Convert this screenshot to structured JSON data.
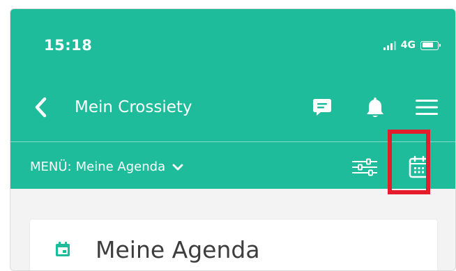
{
  "status_bar": {
    "time": "15:18",
    "network": "4G"
  },
  "nav": {
    "title": "Mein Crossiety",
    "back_icon": "chevron-left-icon",
    "chat_icon": "chat-icon",
    "bell_icon": "bell-icon",
    "menu_icon": "hamburger-menu-icon"
  },
  "submenu": {
    "label": "MENÜ:",
    "selected": "Meine Agenda",
    "filter_icon": "filter-sliders-icon",
    "calendar_icon": "calendar-icon"
  },
  "card": {
    "title": "Meine Agenda",
    "icon": "calendar-icon"
  },
  "colors": {
    "primary": "#1fbc9c",
    "highlight": "#e51d2a",
    "background": "#f3f3f3",
    "card_text": "#3d3d3d"
  }
}
